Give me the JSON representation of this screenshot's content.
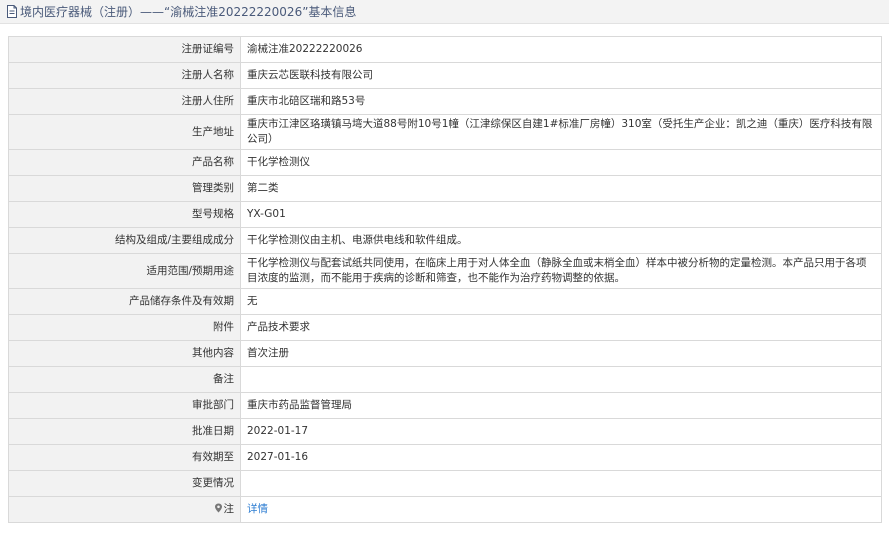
{
  "header": {
    "title": "境内医疗器械（注册）——“渝械注准20222220026”基本信息"
  },
  "rows": [
    {
      "label": "注册证编号",
      "value": "渝械注准20222220026"
    },
    {
      "label": "注册人名称",
      "value": "重庆云芯医联科技有限公司"
    },
    {
      "label": "注册人住所",
      "value": "重庆市北碚区瑞和路53号"
    },
    {
      "label": "生产地址",
      "value": "重庆市江津区珞璜镇马塆大道88号附10号1幢（江津综保区自建1#标准厂房幢）310室（受托生产企业：凯之迪（重庆）医疗科技有限公司）"
    },
    {
      "label": "产品名称",
      "value": "干化学检测仪"
    },
    {
      "label": "管理类别",
      "value": "第二类"
    },
    {
      "label": "型号规格",
      "value": "YX-G01"
    },
    {
      "label": "结构及组成/主要组成成分",
      "value": "干化学检测仪由主机、电源供电线和软件组成。"
    },
    {
      "label": "适用范围/预期用途",
      "value": "干化学检测仪与配套试纸共同使用，在临床上用于对人体全血（静脉全血或末梢全血）样本中被分析物的定量检测。本产品只用于各项目浓度的监测，而不能用于疾病的诊断和筛查，也不能作为治疗药物调整的依据。"
    },
    {
      "label": "产品储存条件及有效期",
      "value": "无"
    },
    {
      "label": "附件",
      "value": "产品技术要求"
    },
    {
      "label": "其他内容",
      "value": "首次注册"
    },
    {
      "label": "备注",
      "value": ""
    },
    {
      "label": "审批部门",
      "value": "重庆市药品监督管理局"
    },
    {
      "label": "批准日期",
      "value": "2022-01-17"
    },
    {
      "label": "有效期至",
      "value": "2027-01-16"
    },
    {
      "label": "变更情况",
      "value": ""
    },
    {
      "label": "注",
      "value": "详情"
    }
  ],
  "icons": {
    "title": "document-icon",
    "note": "map-pin-icon"
  },
  "colors": {
    "title_text": "#4a5a7a",
    "label_bg": "#f2f2f2",
    "border": "#d9d9d9",
    "link": "#2d7dd2"
  }
}
